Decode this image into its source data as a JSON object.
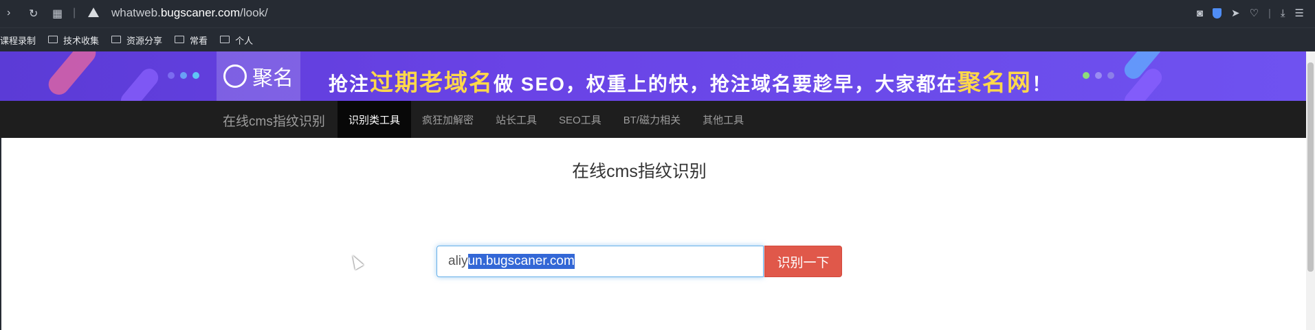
{
  "browser": {
    "url_prefix": "whatweb.",
    "url_domain": "bugscaner.com",
    "url_path": "/look/",
    "bookmarks": [
      "课程录制",
      "技术收集",
      "资源分享",
      "常看",
      "个人"
    ]
  },
  "banner": {
    "logo_text": "聚名",
    "slogan_1": "抢注",
    "slogan_hl1": "过期老域名",
    "slogan_2": "做 SEO，权重上的快，抢注域名要趁早，大家都在",
    "slogan_hl2": "聚名网",
    "slogan_3": "！"
  },
  "navbar": {
    "brand": "在线cms指纹识别",
    "items": [
      "识别类工具",
      "疯狂加解密",
      "站长工具",
      "SEO工具",
      "BT/磁力相关",
      "其他工具"
    ],
    "active_index": 0
  },
  "main": {
    "title": "在线cms指纹识别",
    "input_unselected": "aliy",
    "input_selected": "un.bugscaner.com",
    "button_label": "识别一下"
  },
  "colors": {
    "navbar_bg": "#1e1e1e",
    "banner_bg": "#6a43e6",
    "button_bg": "#e0584a",
    "focus_border": "#66afe9"
  }
}
